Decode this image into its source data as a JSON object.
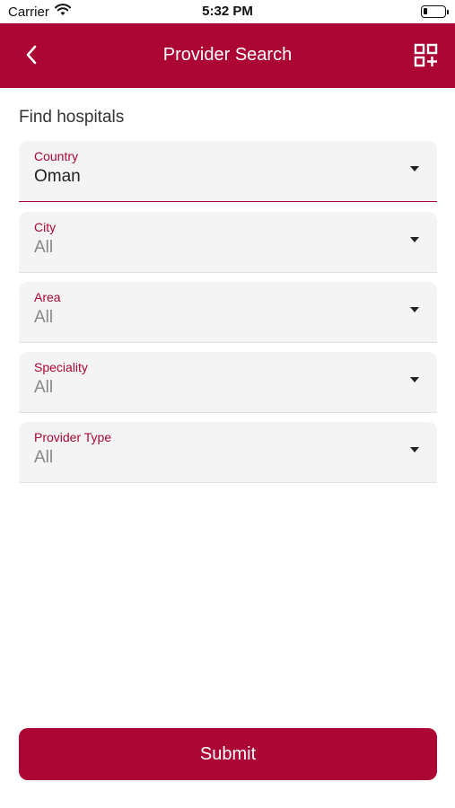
{
  "status_bar": {
    "carrier": "Carrier",
    "time": "5:32 PM"
  },
  "header": {
    "title": "Provider Search",
    "back_icon": "chevron-left-icon",
    "action_icon": "qr-add-icon"
  },
  "form": {
    "section_title": "Find hospitals",
    "fields": [
      {
        "label": "Country",
        "value": "Oman"
      },
      {
        "label": "City",
        "value": "All"
      },
      {
        "label": "Area",
        "value": "All"
      },
      {
        "label": "Speciality",
        "value": "All"
      },
      {
        "label": "Provider Type",
        "value": "All"
      }
    ],
    "submit_label": "Submit"
  },
  "colors": {
    "brand": "#ab0634",
    "field_bg": "#f4f4f4"
  }
}
